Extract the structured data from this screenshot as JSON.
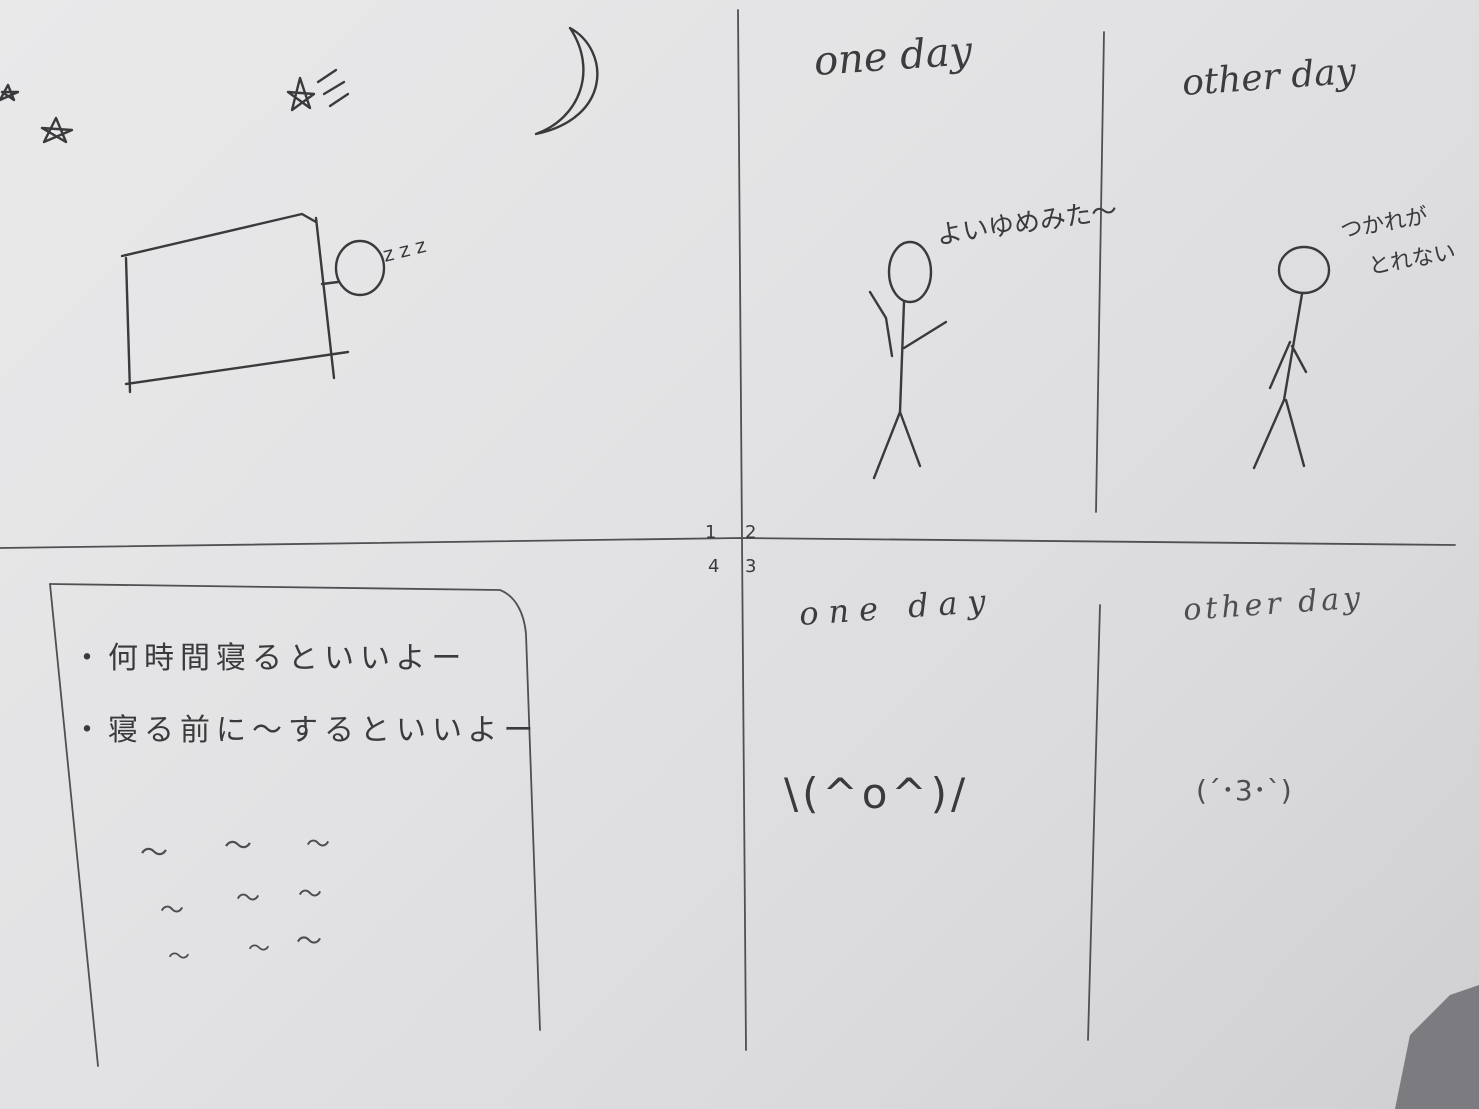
{
  "sketch": {
    "panel_numbers": [
      "1",
      "2",
      "3",
      "4"
    ],
    "panel2": {
      "heading": "one day",
      "speech": "よいゆめみた〜"
    },
    "panel2b": {
      "heading": "other day",
      "speech_line1": "つかれが",
      "speech_line2": "とれない"
    },
    "panel1": {
      "sleep_sound": "zzz"
    },
    "panel4": {
      "line1": "・何時間寝るといいよー",
      "line2": "・寝る前に〜するといいよー",
      "squiggles": [
        [
          "〜",
          "〜",
          "〜"
        ],
        [
          "〜",
          "〜",
          "〜"
        ],
        [
          "〜",
          "〜",
          "〜"
        ]
      ]
    },
    "panel3": {
      "heading": "one day",
      "face": "\\(^o^)/"
    },
    "panel3b": {
      "heading": "other day",
      "face": "(´･3･`)"
    }
  }
}
